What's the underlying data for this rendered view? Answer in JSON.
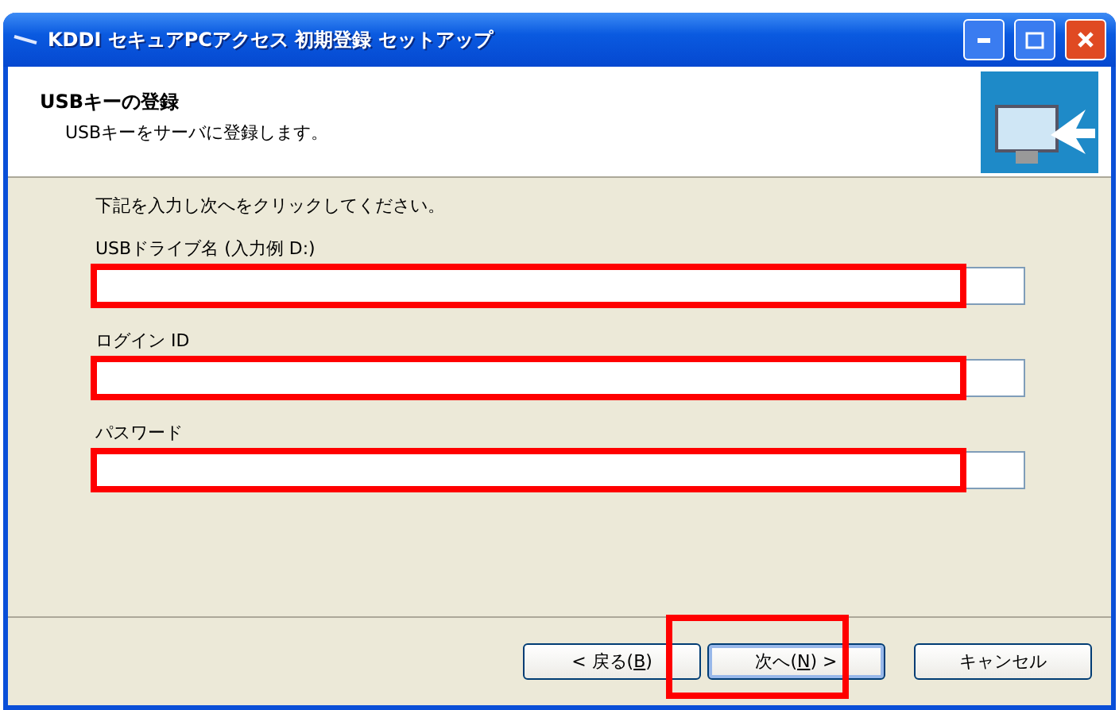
{
  "window": {
    "title": "KDDI セキュアPCアクセス 初期登録 セットアップ"
  },
  "header": {
    "title": "USBキーの登録",
    "subtitle": "USBキーをサーバに登録します。"
  },
  "instruction": "下記を入力し次へをクリックしてください。",
  "fields": [
    {
      "label": "USBドライブ名 (入力例 D:)",
      "highlighted": true
    },
    {
      "label": "ログイン ID",
      "highlighted": true
    },
    {
      "label": "パスワード",
      "highlighted": true
    }
  ],
  "buttons": [
    {
      "before": "< 戻る(",
      "mnemonic": "B",
      "after": ")",
      "default": false,
      "highlighted": false
    },
    {
      "before": "次へ(",
      "mnemonic": "N",
      "after": ") >",
      "default": true,
      "highlighted": true
    },
    {
      "before": "キャンセル",
      "default": false,
      "highlighted": false
    }
  ]
}
